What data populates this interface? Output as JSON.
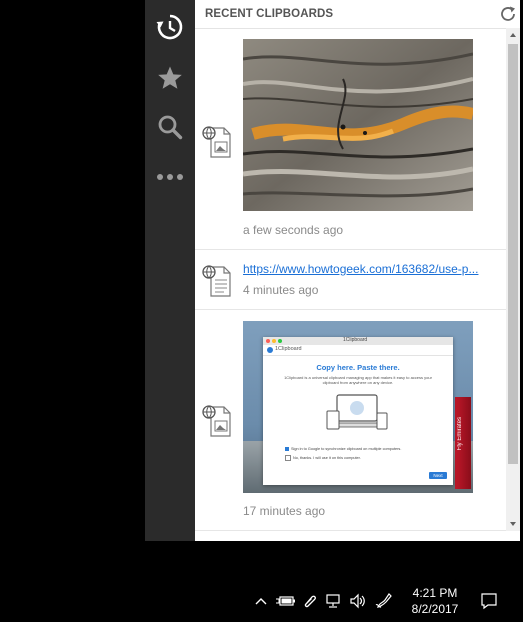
{
  "app": {
    "header_title": "RECENT CLIPBOARDS"
  },
  "rail": {
    "items": [
      {
        "name": "history",
        "icon": "history-icon",
        "active": true
      },
      {
        "name": "favorites",
        "icon": "star-icon",
        "active": false
      },
      {
        "name": "search",
        "icon": "search-icon",
        "active": false
      },
      {
        "name": "more",
        "icon": "more-icon",
        "active": false
      }
    ]
  },
  "clips": [
    {
      "type": "image",
      "description_icon": "web-file-icon",
      "time": "a few seconds ago"
    },
    {
      "type": "link",
      "description_icon": "web-file-icon",
      "text": "https://www.howtogeek.com/163682/use-p...",
      "time": "4 minutes ago"
    },
    {
      "type": "image",
      "description_icon": "web-file-icon",
      "time": "17 minutes ago",
      "screenshot": {
        "window_title": "1Clipboard",
        "brand": "1Clipboard",
        "heading": "Copy here. Paste there.",
        "body": "1Clipboard is a universal clipboard managing app that makes it easy to access your clipboard from anywhere on any device.",
        "option1": "Sign in to Google to synchronize clipboard on multiple computers.",
        "option2": "No, thanks. I will use it on this computer.",
        "button": "Next",
        "sail_text": "Fly Emirates"
      }
    }
  ],
  "taskbar": {
    "time": "4:21 PM",
    "date": "8/2/2017",
    "tray_icons": [
      "chevron-up-icon",
      "battery-icon",
      "clip-icon",
      "network-icon",
      "volume-icon",
      "pen-icon",
      "action-center-icon"
    ]
  },
  "colors": {
    "rail_bg": "#2b2b2b",
    "link": "#1a6fd6",
    "accent_blue": "#2a7bd5"
  }
}
